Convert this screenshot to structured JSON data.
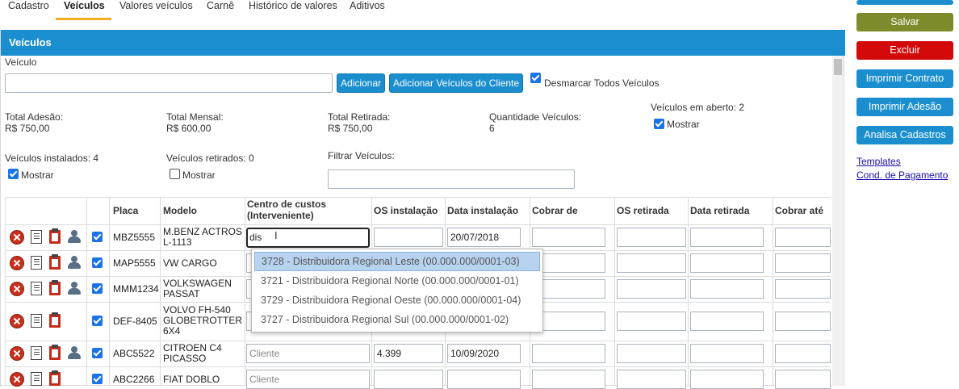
{
  "tabs": [
    "Cadastro",
    "Veículos",
    "Valores veículos",
    "Carnê",
    "Histórico de valores",
    "Aditivos"
  ],
  "panel": {
    "title": "Veículos"
  },
  "vehicle_field": {
    "label": "Veículo",
    "value": ""
  },
  "buttons": {
    "add": "Adicionar",
    "add_client": "Adicionar Veículos do Cliente",
    "uncheck_all": "Desmarcar Todos Veículos"
  },
  "summary": {
    "total_adesao_label": "Total Adesão:",
    "total_adesao": "R$ 750,00",
    "total_mensal_label": "Total Mensal:",
    "total_mensal": "R$ 600,00",
    "total_retirada_label": "Total Retirada:",
    "total_retirada": "R$ 750,00",
    "qtd_label": "Quantidade Veículos:",
    "qtd": "6",
    "em_aberto": "Veículos em aberto: 2",
    "instalados": "Veículos instalados: 4",
    "retirados": "Veículos retirados: 0",
    "mostrar": "Mostrar",
    "filtrar_label": "Filtrar Veículos:"
  },
  "columns": [
    "Placa",
    "Modelo",
    "Centro de custos (Interveniente)",
    "OS instalação",
    "Data instalação",
    "Cobrar de",
    "OS retirada",
    "Data retirada",
    "Cobrar até"
  ],
  "rows": [
    {
      "placa": "MBZ5555",
      "modelo": "M.BENZ ACTROS L-1113",
      "centro": "dis",
      "os_inst": "",
      "data_inst": "20/07/2018"
    },
    {
      "placa": "MAP5555",
      "modelo": "VW CARGO",
      "centro": "",
      "os_inst": "",
      "data_inst": ""
    },
    {
      "placa": "MMM1234",
      "modelo": "VOLKSWAGEN PASSAT",
      "centro": "",
      "os_inst": "",
      "data_inst": ""
    },
    {
      "placa": "DEF-8405",
      "modelo": "VOLVO FH-540 GLOBETROTTER 6X4",
      "centro": "",
      "os_inst": "",
      "data_inst": ""
    },
    {
      "placa": "ABC5522",
      "modelo": "CITROEN C4 PICASSO",
      "centro": "Cliente",
      "os_inst": "4.399",
      "data_inst": "10/09/2020"
    },
    {
      "placa": "ABC2266",
      "modelo": "FIAT DOBLO",
      "centro": "Cliente",
      "os_inst": "",
      "data_inst": ""
    }
  ],
  "dropdown": [
    "3728 - Distribuidora Regional Leste (00.000.000/0001-03)",
    "3721 - Distribuidora Regional Norte (00.000.000/0001-01)",
    "3729 - Distribuidora Regional Oeste (00.000.000/0001-04)",
    "3727 - Distribuidora Regional Sul (00.000.000/0001-02)"
  ],
  "actions": [
    "Salvar",
    "Excluir",
    "Imprimir Contrato",
    "Imprimir Adesão",
    "Analisa Cadastros"
  ],
  "links": [
    "Templates",
    "Cond. de Pagamento"
  ],
  "colors": {
    "primary": "#1b8ecf",
    "save": "#7f8b2a",
    "delete": "#d40a0a",
    "tab_accent": "#f0ad1e"
  }
}
